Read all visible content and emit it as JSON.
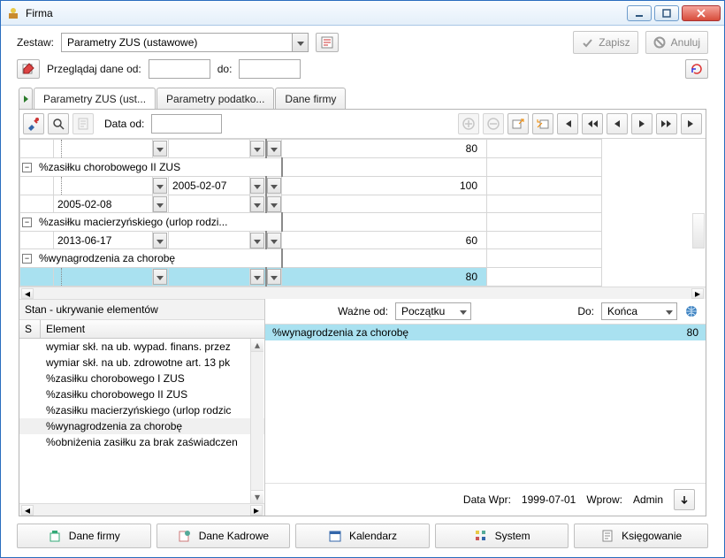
{
  "window": {
    "title": "Firma"
  },
  "toolbar": {
    "zestaw_label": "Zestaw:",
    "zestaw_value": "Parametry ZUS (ustawowe)",
    "zapisz": "Zapisz",
    "anuluj": "Anuluj",
    "browse_label": "Przeglądaj dane od:",
    "do_label": "do:",
    "from_value": "",
    "to_value": ""
  },
  "tabs": {
    "t0": "Parametry ZUS (ust...",
    "t1": "Parametry podatko...",
    "t2": "Dane firmy"
  },
  "gridbar": {
    "data_od": "Data od:",
    "data_od_value": ""
  },
  "grid": {
    "r0_val": "80",
    "g1_label": "%zasiłku chorobowego II ZUS",
    "g1_r0_d2": "2005-02-07",
    "g1_r0_val": "100",
    "g1_r1_d1": "2005-02-08",
    "g2_label": "%zasiłku macierzyńskiego (urlop rodzi...",
    "g2_r0_d1": "2013-06-17",
    "g2_r0_val": "60",
    "g3_label": "%wynagrodzenia za chorobę",
    "g3_r0_val": "80"
  },
  "leftpane": {
    "title": "Stan - ukrywanie elementów",
    "col_s": "S",
    "col_el": "Element",
    "items": [
      "wymiar skł. na ub. wypad. finans. przez",
      "wymiar skł. na ub. zdrowotne art. 13 pk",
      "%zasiłku chorobowego I ZUS",
      "%zasiłku chorobowego II ZUS",
      "%zasiłku macierzyńskiego (urlop rodzic",
      "%wynagrodzenia za chorobę",
      "%obniżenia zasiłku za brak zaświadczen"
    ]
  },
  "rightpane": {
    "wazne_od": "Ważne od:",
    "wazne_od_v": "Początku",
    "do": "Do:",
    "do_v": "Końca",
    "row_label": "%wynagrodzenia za chorobę",
    "row_val": "80"
  },
  "status": {
    "datawpr_l": "Data Wpr:",
    "datawpr_v": "1999-07-01",
    "wprow_l": "Wprow:",
    "wprow_v": "Admin"
  },
  "bottom": {
    "b1": "Dane firmy",
    "b2": "Dane Kadrowe",
    "b3": "Kalendarz",
    "b4": "System",
    "b5": "Księgowanie"
  }
}
